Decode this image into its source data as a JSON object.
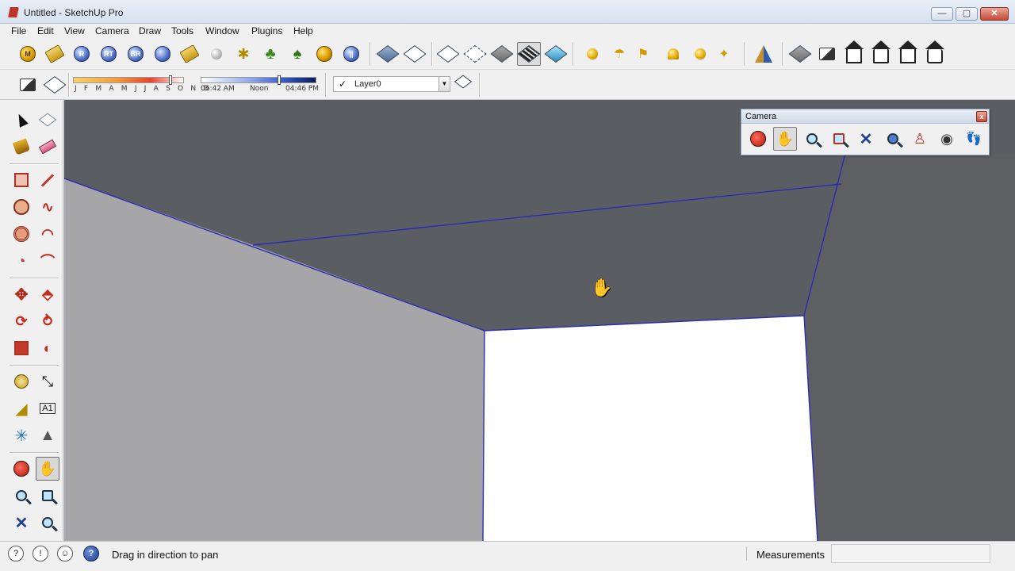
{
  "window": {
    "title": "Untitled - SketchUp Pro",
    "min_glyph": "—",
    "max_glyph": "▢",
    "close_glyph": "✕"
  },
  "menu": [
    "File",
    "Edit",
    "View",
    "Camera",
    "Draw",
    "Tools",
    "Window",
    "Plugins",
    "Help"
  ],
  "toolbar_top": {
    "plugin_buttons": [
      "M",
      "",
      "R",
      "RT",
      "BR",
      "",
      "",
      "",
      "",
      "",
      "",
      "",
      ""
    ],
    "icons": [
      "plugin-m-icon",
      "tag-icon",
      "plugin-r-icon",
      "plugin-rt-icon",
      "plugin-br-icon",
      "plugin-info-icon",
      "tag-icon",
      "sphere-icon",
      "bug-icon",
      "tree-icon",
      "tree-icon",
      "render-icon",
      "pause-icon"
    ]
  },
  "shadows": {
    "months": "J F M A M J J A S O N D",
    "time_start": "06:42 AM",
    "time_mid": "Noon",
    "time_end": "04:46 PM"
  },
  "layer": {
    "check": "✓",
    "name": "Layer0",
    "arrow": "▼"
  },
  "camera_panel": {
    "title": "Camera",
    "close": "x",
    "tools": [
      "orbit-icon",
      "pan-icon",
      "zoom-icon",
      "zoom-window-icon",
      "zoom-extents-icon",
      "previous-view-icon",
      "position-camera-icon",
      "look-around-icon",
      "walk-icon"
    ]
  },
  "status": {
    "hint": "Drag in direction to pan",
    "measurements_label": "Measurements",
    "measurements_value": "",
    "help_glyph": "?",
    "geo_glyph": "?",
    "credit_glyph": "!",
    "user_glyph": "☺"
  },
  "colors": {
    "ceiling": "#5a5d62",
    "left_wall": "#a6a6a8",
    "right_wall": "#5d5f63",
    "back_wall": "#ffffff",
    "edge": "#2b2bb5"
  }
}
